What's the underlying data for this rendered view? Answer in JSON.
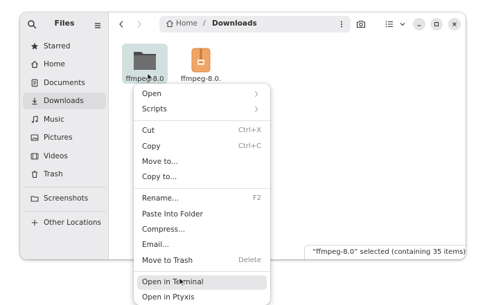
{
  "sidebar": {
    "title": "Files",
    "items": [
      {
        "label": "Starred",
        "icon": "star-icon"
      },
      {
        "label": "Home",
        "icon": "home-icon"
      },
      {
        "label": "Documents",
        "icon": "document-icon"
      },
      {
        "label": "Downloads",
        "icon": "download-icon",
        "active": true
      },
      {
        "label": "Music",
        "icon": "music-icon"
      },
      {
        "label": "Pictures",
        "icon": "picture-icon"
      },
      {
        "label": "Videos",
        "icon": "video-icon"
      },
      {
        "label": "Trash",
        "icon": "trash-icon"
      },
      {
        "label": "Screenshots",
        "icon": "folder-icon"
      },
      {
        "label": "Other Locations",
        "icon": "plus-icon"
      }
    ]
  },
  "pathbar": {
    "home_label": "Home",
    "separator": "/",
    "current": "Downloads"
  },
  "files": [
    {
      "name": "ffmpeg-8.0",
      "type": "folder",
      "selected": true
    },
    {
      "name": "ffmpeg-8.0.",
      "type": "archive",
      "selected": false
    }
  ],
  "status": {
    "text": "“ffmpeg-8.0” selected  (containing 35 items)"
  },
  "context_menu": {
    "items": [
      {
        "label": "Open",
        "submenu": true
      },
      {
        "label": "Scripts",
        "submenu": true
      },
      {
        "label": "Cut",
        "accel": "Ctrl+X"
      },
      {
        "label": "Copy",
        "accel": "Ctrl+C"
      },
      {
        "label": "Move to..."
      },
      {
        "label": "Copy to..."
      },
      {
        "label": "Rename...",
        "accel": "F2"
      },
      {
        "label": "Paste Into Folder"
      },
      {
        "label": "Compress..."
      },
      {
        "label": "Email..."
      },
      {
        "label": "Move to Trash",
        "accel": "Delete"
      },
      {
        "label": "Open in Terminal",
        "hover": true
      },
      {
        "label": "Open in Ptyxis"
      }
    ]
  },
  "colors": {
    "sidebar_bg": "#ebebed",
    "selection_bg": "#d3e0e0",
    "archive_orange": "#f0a566"
  }
}
